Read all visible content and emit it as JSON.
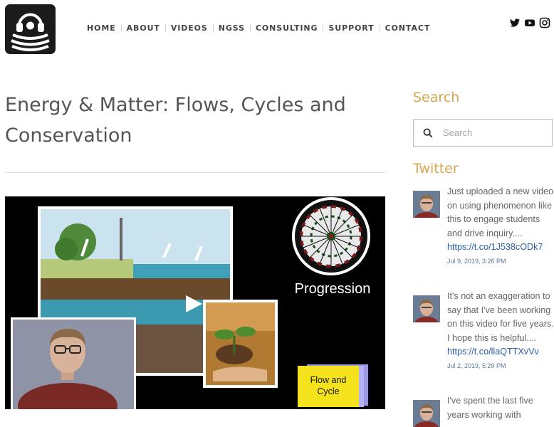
{
  "nav": [
    "HOME",
    "ABOUT",
    "VIDEOS",
    "NGSS",
    "CONSULTING",
    "SUPPORT",
    "CONTACT"
  ],
  "social": [
    "twitter-icon",
    "youtube-icon",
    "instagram-icon"
  ],
  "page_title": "Energy & Matter:  Flows, Cycles and Conservation",
  "video": {
    "overlay_progression": "Progression",
    "overlay_flow": "Flow and Cycle"
  },
  "sidebar": {
    "search_heading": "Search",
    "search_placeholder": "Search",
    "twitter_heading": "Twitter",
    "tweets": [
      {
        "text": "Just uploaded a new video on using phenomenon like this to engage students and drive inquiry....",
        "link": "https://t.co/1J538cODk7",
        "date": "Jul 9, 2019, 3:26 PM"
      },
      {
        "text": "It's not an exaggeration to say that I've been working on this video for five years. I hope this is helpful....",
        "link": "https://t.co/llaQTTXvVv",
        "date": "Jul 2, 2019, 5:29 PM"
      },
      {
        "text": "I've spent the last five years working with",
        "link": "",
        "date": ""
      }
    ]
  },
  "colors": {
    "accent": "#d7a74f",
    "link": "#2a5ea8"
  }
}
